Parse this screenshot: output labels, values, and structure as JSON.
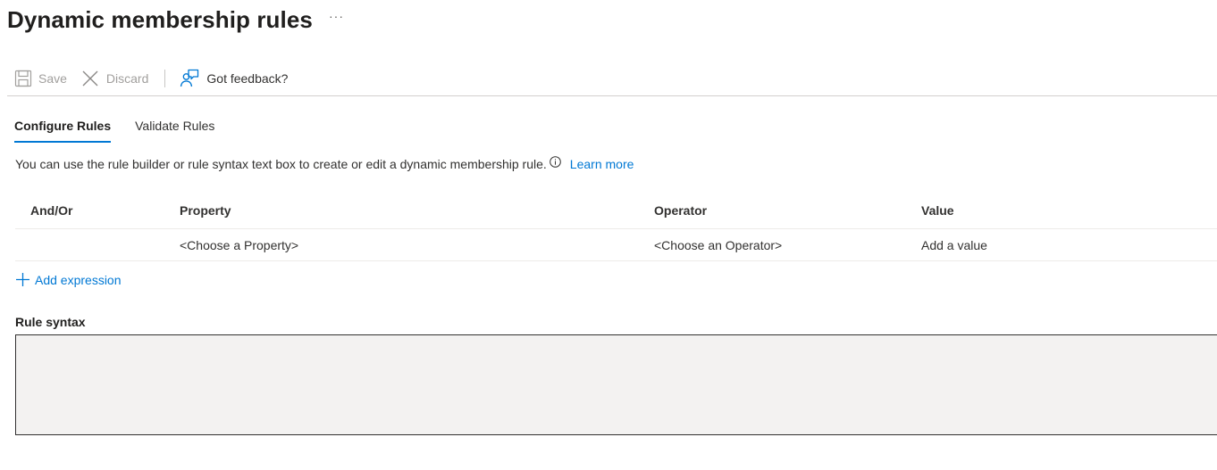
{
  "page": {
    "title": "Dynamic membership rules",
    "more_label": "···"
  },
  "toolbar": {
    "save_label": "Save",
    "discard_label": "Discard",
    "feedback_label": "Got feedback?"
  },
  "tabs": [
    {
      "label": "Configure Rules",
      "active": true
    },
    {
      "label": "Validate Rules",
      "active": false
    }
  ],
  "description": {
    "text": "You can use the rule builder or rule syntax text box to create or edit a dynamic membership rule.",
    "link_label": "Learn more"
  },
  "rule_grid": {
    "columns": [
      "And/Or",
      "Property",
      "Operator",
      "Value"
    ],
    "rows": [
      {
        "and_or": "",
        "property": "<Choose a Property>",
        "operator": "<Choose an Operator>",
        "value": "Add a value"
      }
    ]
  },
  "add_expression_label": "Add expression",
  "rule_syntax": {
    "label": "Rule syntax",
    "value": ""
  },
  "colors": {
    "accent": "#0078d4",
    "text": "#323130",
    "disabled": "#a19f9d",
    "syntax_bg": "#f3f2f1"
  }
}
